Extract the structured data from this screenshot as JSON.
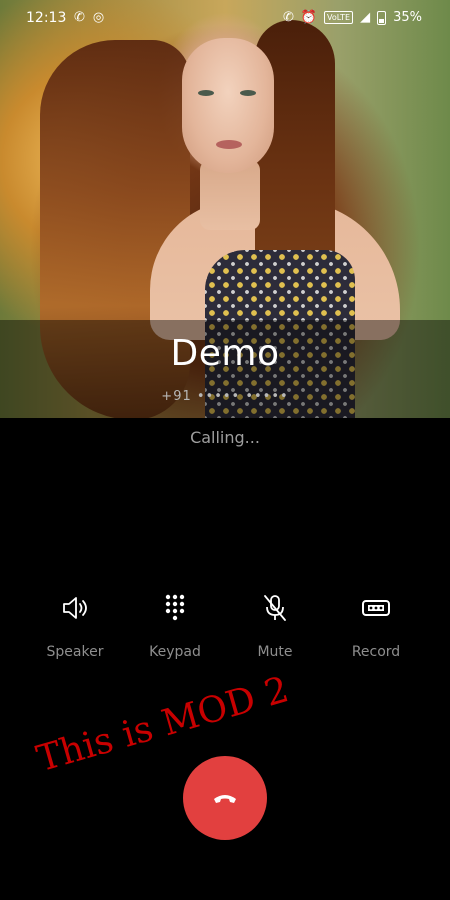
{
  "status_bar": {
    "time": "12:13",
    "network_label": "VoLTE",
    "battery": "35%"
  },
  "caller": {
    "name": "Demo",
    "number": "+91 ••••• •••••"
  },
  "call_status": "Calling...",
  "controls": [
    {
      "label": "Speaker",
      "icon": "speaker-icon"
    },
    {
      "label": "Keypad",
      "icon": "keypad-icon"
    },
    {
      "label": "Mute",
      "icon": "mute-icon"
    },
    {
      "label": "Record",
      "icon": "record-icon"
    }
  ],
  "watermark": "This is MOD 2",
  "colors": {
    "end_call": "#e2403f",
    "watermark": "#c80000",
    "label_gray": "#8e8e8e"
  }
}
